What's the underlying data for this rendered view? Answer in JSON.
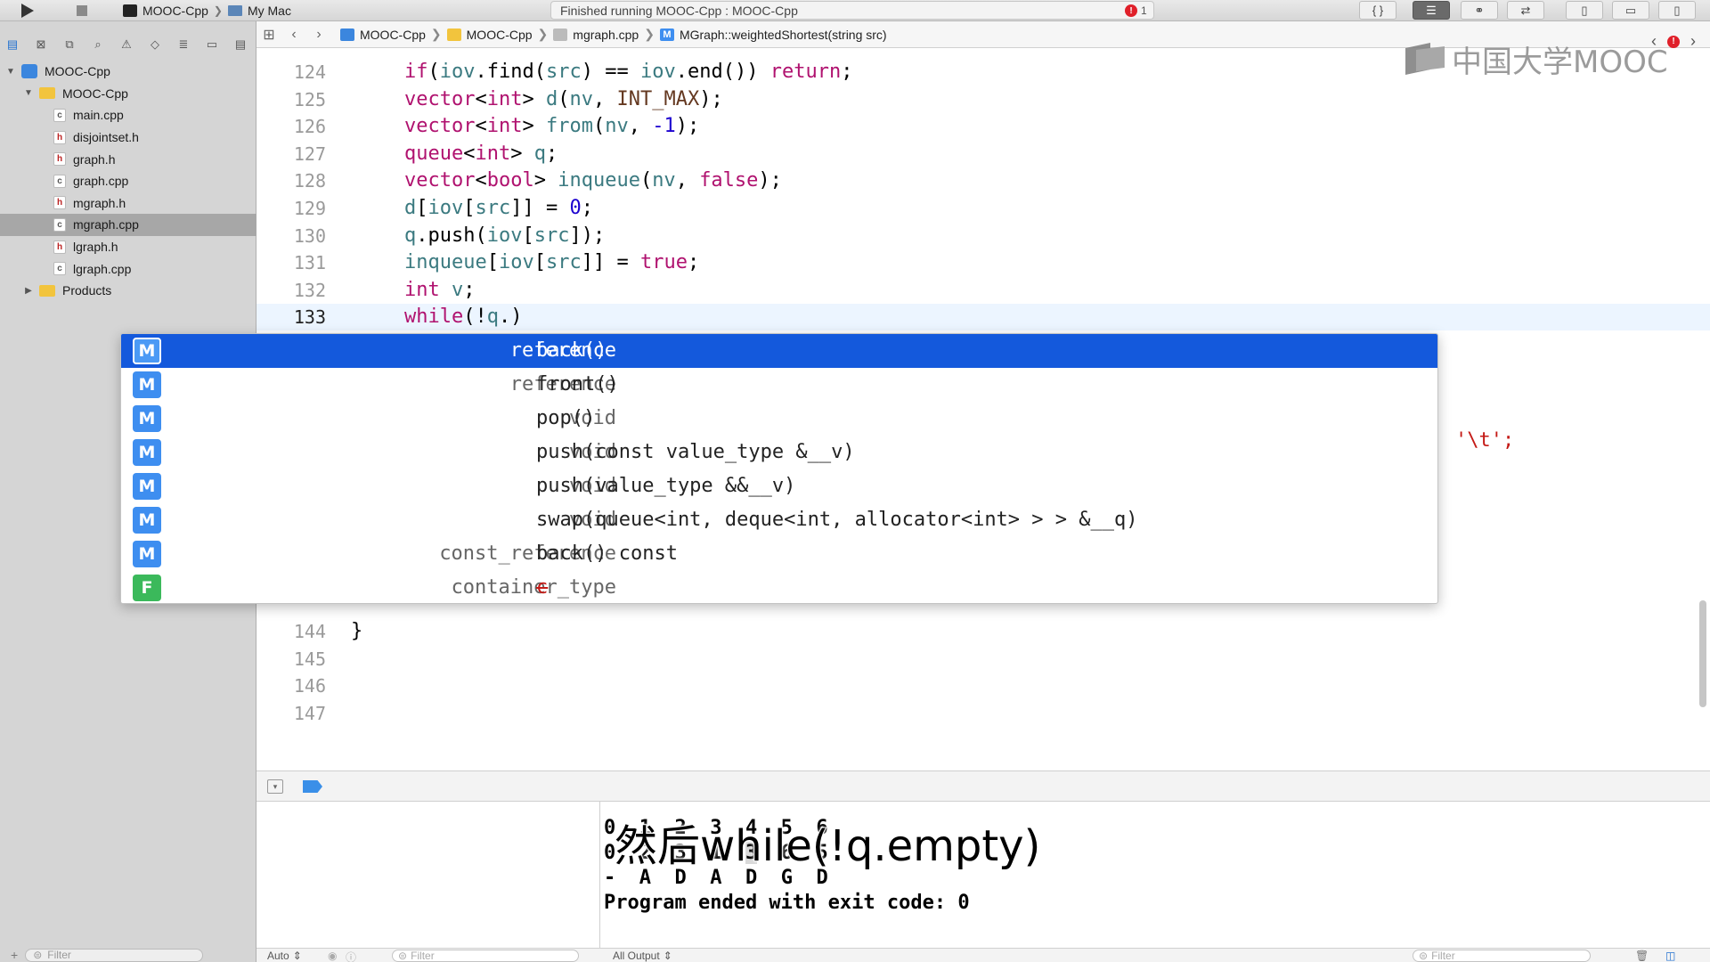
{
  "toolbar": {
    "run_icon": "play-icon",
    "stop_icon": "stop-icon",
    "scheme_name": "MOOC-Cpp",
    "destination": "My Mac",
    "status_text": "Finished running MOOC-Cpp : MOOC-Cpp",
    "error_count": "1"
  },
  "navigator": {
    "tabs": [
      "folder-icon",
      "source-control-icon",
      "hierarchy-icon",
      "search-icon",
      "warning-icon",
      "test-icon",
      "debug-icon",
      "breakpoint-icon",
      "report-icon"
    ],
    "tree": [
      {
        "label": "MOOC-Cpp",
        "kind": "project",
        "expanded": true
      },
      {
        "label": "MOOC-Cpp",
        "kind": "folder",
        "expanded": true
      },
      {
        "label": "main.cpp",
        "kind": "cpp"
      },
      {
        "label": "disjointset.h",
        "kind": "h"
      },
      {
        "label": "graph.h",
        "kind": "h"
      },
      {
        "label": "graph.cpp",
        "kind": "cpp"
      },
      {
        "label": "mgraph.h",
        "kind": "h"
      },
      {
        "label": "mgraph.cpp",
        "kind": "cpp",
        "selected": true
      },
      {
        "label": "lgraph.h",
        "kind": "h"
      },
      {
        "label": "lgraph.cpp",
        "kind": "cpp"
      },
      {
        "label": "Products",
        "kind": "folder",
        "expanded": false
      }
    ],
    "filter_placeholder": "Filter"
  },
  "jumpbar": {
    "crumbs": [
      "MOOC-Cpp",
      "MOOC-Cpp",
      "mgraph.cpp",
      "MGraph::weightedShortest(string src)"
    ]
  },
  "editor": {
    "lines": [
      {
        "n": "124",
        "code": "if(iov.find(src) == iov.end()) return;"
      },
      {
        "n": "125",
        "code": "vector<int> d(nv, INT_MAX);"
      },
      {
        "n": "126",
        "code": "vector<int> from(nv, -1);"
      },
      {
        "n": "127",
        "code": "queue<int> q;"
      },
      {
        "n": "128",
        "code": "vector<bool> inqueue(nv, false);"
      },
      {
        "n": "129",
        "code": "d[iov[src]] = 0;"
      },
      {
        "n": "130",
        "code": "q.push(iov[src]);"
      },
      {
        "n": "131",
        "code": "inqueue[iov[src]] = true;"
      },
      {
        "n": "132",
        "code": "int v;"
      },
      {
        "n": "133",
        "code": "while(!q.)",
        "current": true
      }
    ],
    "tail_lines": [
      {
        "n": "144",
        "code": "}"
      },
      {
        "n": "145",
        "code": ""
      },
      {
        "n": "146",
        "code": ""
      },
      {
        "n": "147",
        "code": ""
      }
    ],
    "hidden_fragment": "'\\t';"
  },
  "completion": {
    "items": [
      {
        "badge": "M",
        "ret": "reference",
        "name": "back()",
        "selected": true
      },
      {
        "badge": "M",
        "ret": "reference",
        "name": "front()"
      },
      {
        "badge": "M",
        "ret": "void",
        "name": "pop()"
      },
      {
        "badge": "M",
        "ret": "void",
        "name": "push(const value_type &__v)"
      },
      {
        "badge": "M",
        "ret": "void",
        "name": "push(value_type &&__v)"
      },
      {
        "badge": "M",
        "ret": "void",
        "name": "swap(queue<int, deque<int, allocator<int> > > &__q)"
      },
      {
        "badge": "M",
        "ret": "const_reference",
        "name": "back() const"
      },
      {
        "badge": "F",
        "ret": "container_type",
        "name": "c",
        "strike": true
      }
    ]
  },
  "console": {
    "header_row": "0  1  2  3  4  5  6",
    "row_values": [
      "0",
      "2",
      "3",
      "1",
      "3",
      "6",
      "5"
    ],
    "row_from": [
      "-",
      "A",
      "D",
      "A",
      "D",
      "G",
      "D"
    ],
    "exit_message": "Program ended with exit code: 0",
    "output_selector": "All Output",
    "filter_placeholder": "Filter"
  },
  "variables": {
    "mode": "Auto",
    "filter_placeholder": "Filter"
  },
  "subtitle": "然后while(!q.empty)",
  "watermark": "中国大学MOOC"
}
